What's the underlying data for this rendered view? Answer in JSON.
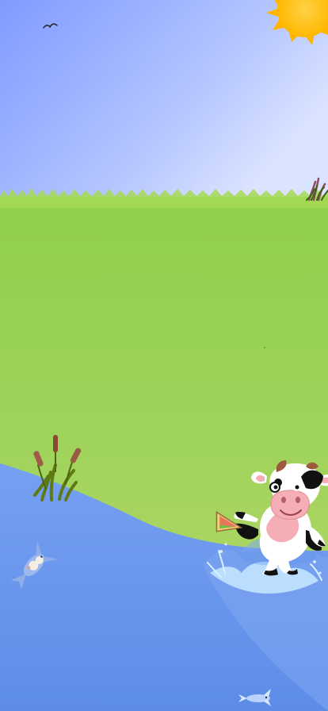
{
  "scene": {
    "colors": {
      "sky_top": "#8da8ff",
      "sky_bottom": "#d8e1ff",
      "grass_top": "#94d14d",
      "grass_bottom": "#b8d869",
      "water_top": "#6d9aef",
      "water_bottom": "#5e8fea",
      "sun": "#ffc21a",
      "cow_spots": "#111111",
      "cow_muzzle": "#f6aeb3",
      "reed_brown": "#8a4a31",
      "reed_green": "#5f7a14",
      "splash": "#bfe1ff"
    },
    "elements": {
      "sun": "sun-icon",
      "bird": "bird-icon",
      "cow": "cow-character-icon",
      "sandwich": "sandwich-icon",
      "koi_left": "koi-fish-icon",
      "koi_bottom": "small-fish-icon",
      "reeds_left": "cattail-reeds-icon",
      "reeds_right": "small-reeds-icon",
      "splash": "water-splash-icon"
    }
  }
}
